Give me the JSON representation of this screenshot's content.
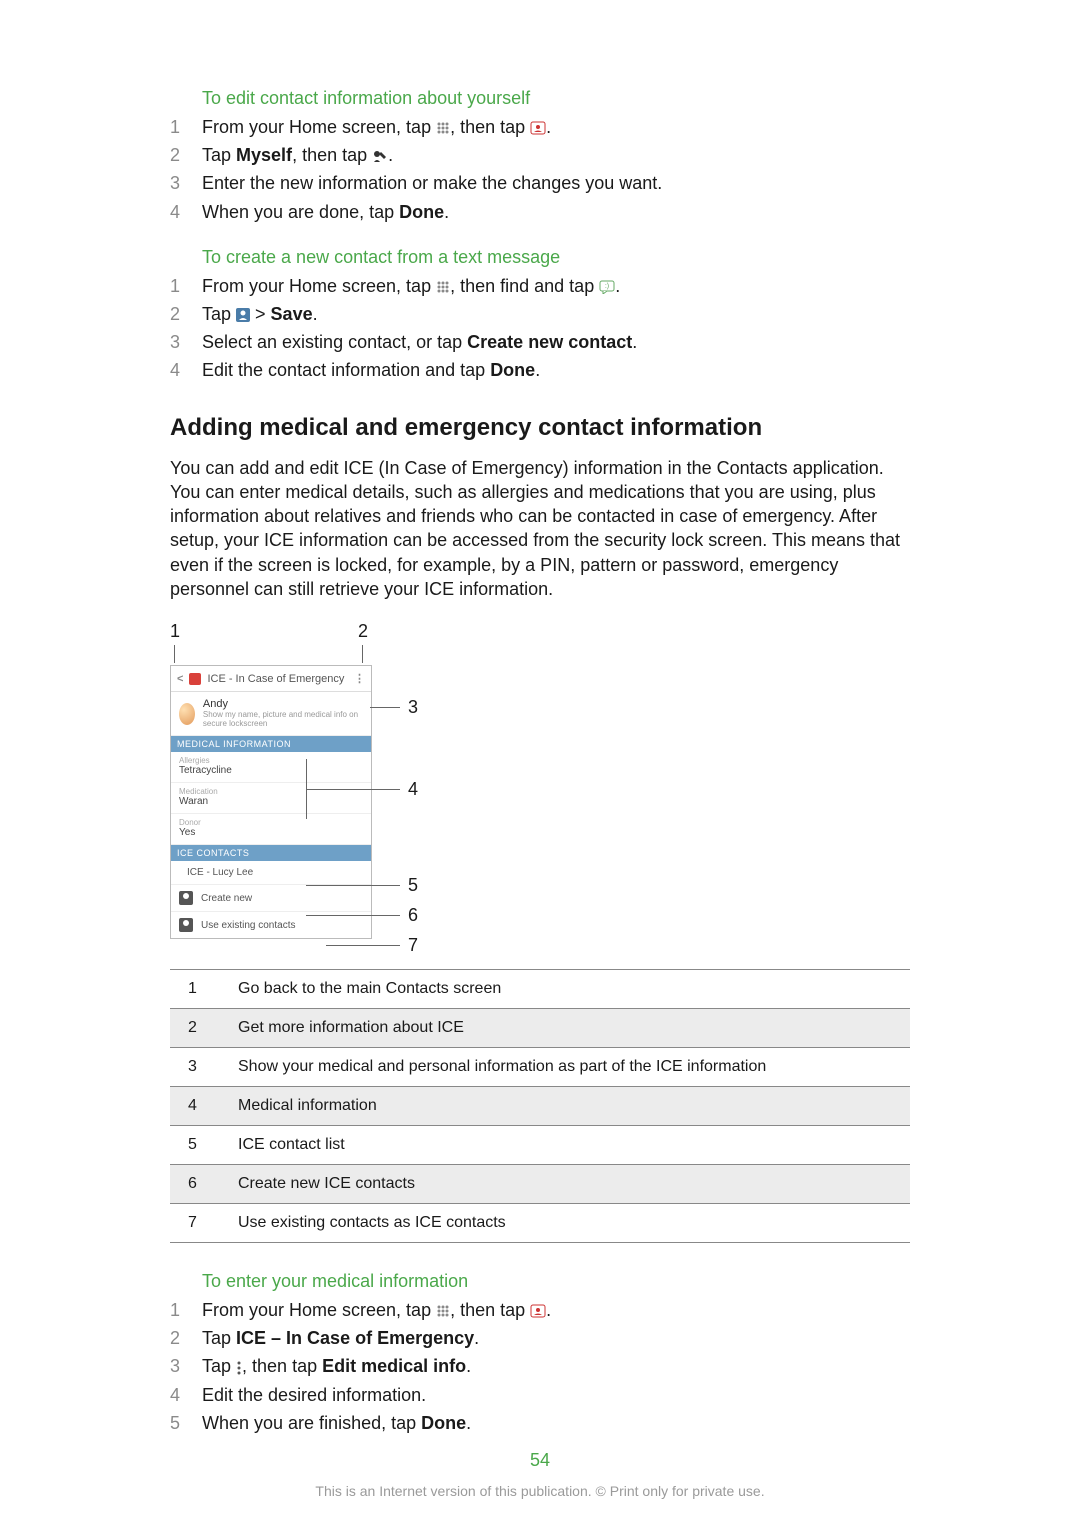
{
  "section1": {
    "heading": "To edit contact information about yourself",
    "steps": [
      "From your Home screen, tap [apps-icon], then tap [contacts-icon].",
      "Tap Myself, then tap [edit-icon].",
      "Enter the new information or make the changes you want.",
      "When you are done, tap Done."
    ]
  },
  "section2": {
    "heading": "To create a new contact from a text message",
    "steps": [
      "From your Home screen, tap [apps-icon], then find and tap [msg-icon].",
      "Tap [contact-icon] > Save.",
      "Select an existing contact, or tap Create new contact.",
      "Edit the contact information and tap Done."
    ]
  },
  "main": {
    "heading": "Adding medical and emergency contact information",
    "para": "You can add and edit ICE (In Case of Emergency) information in the Contacts application. You can enter medical details, such as allergies and medications that you are using, plus information about relatives and friends who can be contacted in case of emergency. After setup, your ICE information can be accessed from the security lock screen. This means that even if the screen is locked, for example, by a PIN, pattern or password, emergency personnel can still retrieve your ICE information."
  },
  "shot": {
    "callout1": "1",
    "callout2": "2",
    "callout3": "3",
    "callout4": "4",
    "callout5": "5",
    "callout6": "6",
    "callout7": "7",
    "headerTitle": "ICE - In Case of Emergency",
    "andy": "Andy",
    "andySub": "Show my name, picture and medical info on secure lockscreen",
    "medLabel": "MEDICAL INFORMATION",
    "allergiesLbl": "Allergies",
    "allergiesVal": "Tetracycline",
    "medicationLbl": "Medication",
    "medicationVal": "Waran",
    "donorLbl": "Donor",
    "donorVal": "Yes",
    "iceLabel": "ICE CONTACTS",
    "iceLucy": "ICE - Lucy Lee",
    "createNew": "Create new",
    "useExisting": "Use existing contacts"
  },
  "legend": [
    {
      "n": "1",
      "t": "Go back to the main Contacts screen"
    },
    {
      "n": "2",
      "t": "Get more information about ICE"
    },
    {
      "n": "3",
      "t": "Show your medical and personal information as part of the ICE information"
    },
    {
      "n": "4",
      "t": "Medical information"
    },
    {
      "n": "5",
      "t": "ICE contact list"
    },
    {
      "n": "6",
      "t": "Create new ICE contacts"
    },
    {
      "n": "7",
      "t": "Use existing contacts as ICE contacts"
    }
  ],
  "section3": {
    "heading": "To enter your medical information",
    "steps": [
      "From your Home screen, tap [apps-icon], then tap [contacts-icon].",
      "Tap ICE – In Case of Emergency.",
      "Tap [more-icon], then tap Edit medical info.",
      "Edit the desired information.",
      "When you are finished, tap Done."
    ]
  },
  "pageNumber": "54",
  "footer": "This is an Internet version of this publication. © Print only for private use."
}
